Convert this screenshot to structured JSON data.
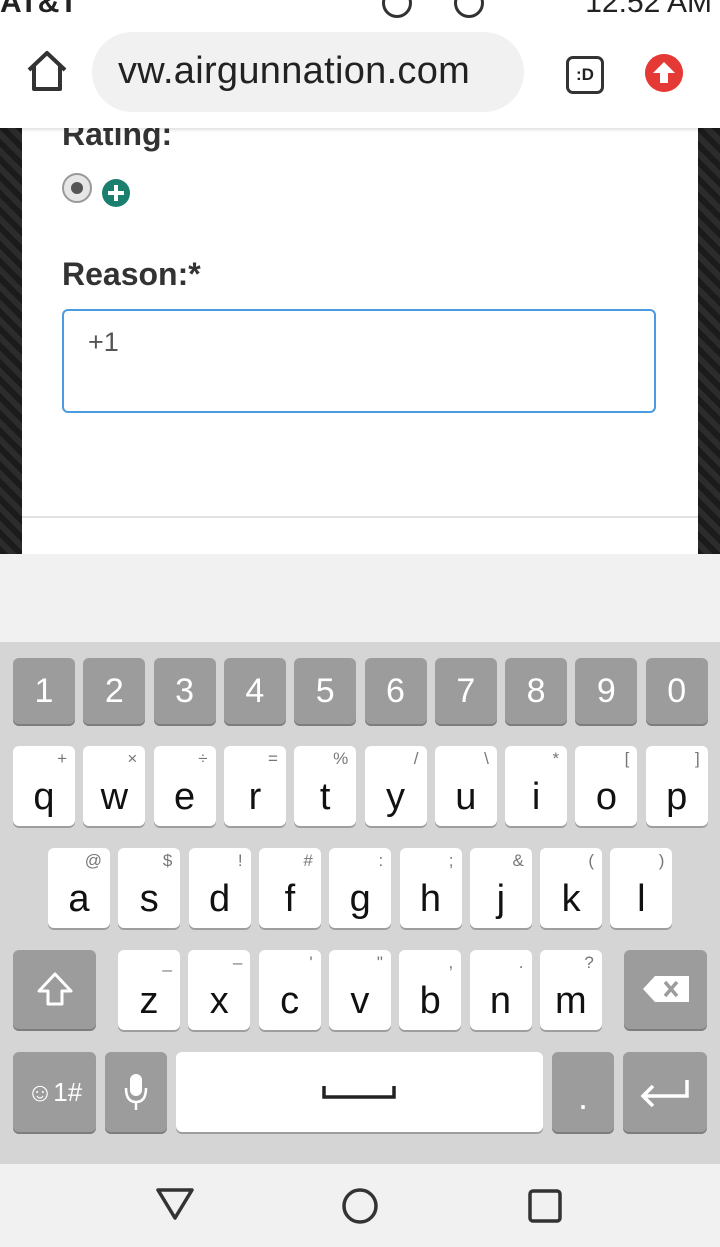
{
  "status_bar": {
    "carrier": "AT&T",
    "time": "12:52 AM"
  },
  "browser": {
    "url": "vw.airgunnation.com",
    "ext_label": ":D"
  },
  "form": {
    "rating_label": "Rating:",
    "reason_label": "Reason:*",
    "reason_value": "+1"
  },
  "keyboard": {
    "numbers": [
      "1",
      "2",
      "3",
      "4",
      "5",
      "6",
      "7",
      "8",
      "9",
      "0"
    ],
    "row1": [
      {
        "main": "q",
        "sub": "+"
      },
      {
        "main": "w",
        "sub": "×"
      },
      {
        "main": "e",
        "sub": "÷"
      },
      {
        "main": "r",
        "sub": "="
      },
      {
        "main": "t",
        "sub": "%"
      },
      {
        "main": "y",
        "sub": "/"
      },
      {
        "main": "u",
        "sub": "\\"
      },
      {
        "main": "i",
        "sub": "*"
      },
      {
        "main": "o",
        "sub": "["
      },
      {
        "main": "p",
        "sub": "]"
      }
    ],
    "row2": [
      {
        "main": "a",
        "sub": "@"
      },
      {
        "main": "s",
        "sub": "$"
      },
      {
        "main": "d",
        "sub": "!"
      },
      {
        "main": "f",
        "sub": "#"
      },
      {
        "main": "g",
        "sub": ":"
      },
      {
        "main": "h",
        "sub": ";"
      },
      {
        "main": "j",
        "sub": "&"
      },
      {
        "main": "k",
        "sub": "("
      },
      {
        "main": "l",
        "sub": ")"
      }
    ],
    "row3": [
      {
        "main": "z",
        "sub": "_"
      },
      {
        "main": "x",
        "sub": "–"
      },
      {
        "main": "c",
        "sub": "'"
      },
      {
        "main": "v",
        "sub": "\""
      },
      {
        "main": "b",
        "sub": ","
      },
      {
        "main": "n",
        "sub": "."
      },
      {
        "main": "m",
        "sub": "?"
      }
    ],
    "symbols_label": "☺1#",
    "period_label": "."
  }
}
